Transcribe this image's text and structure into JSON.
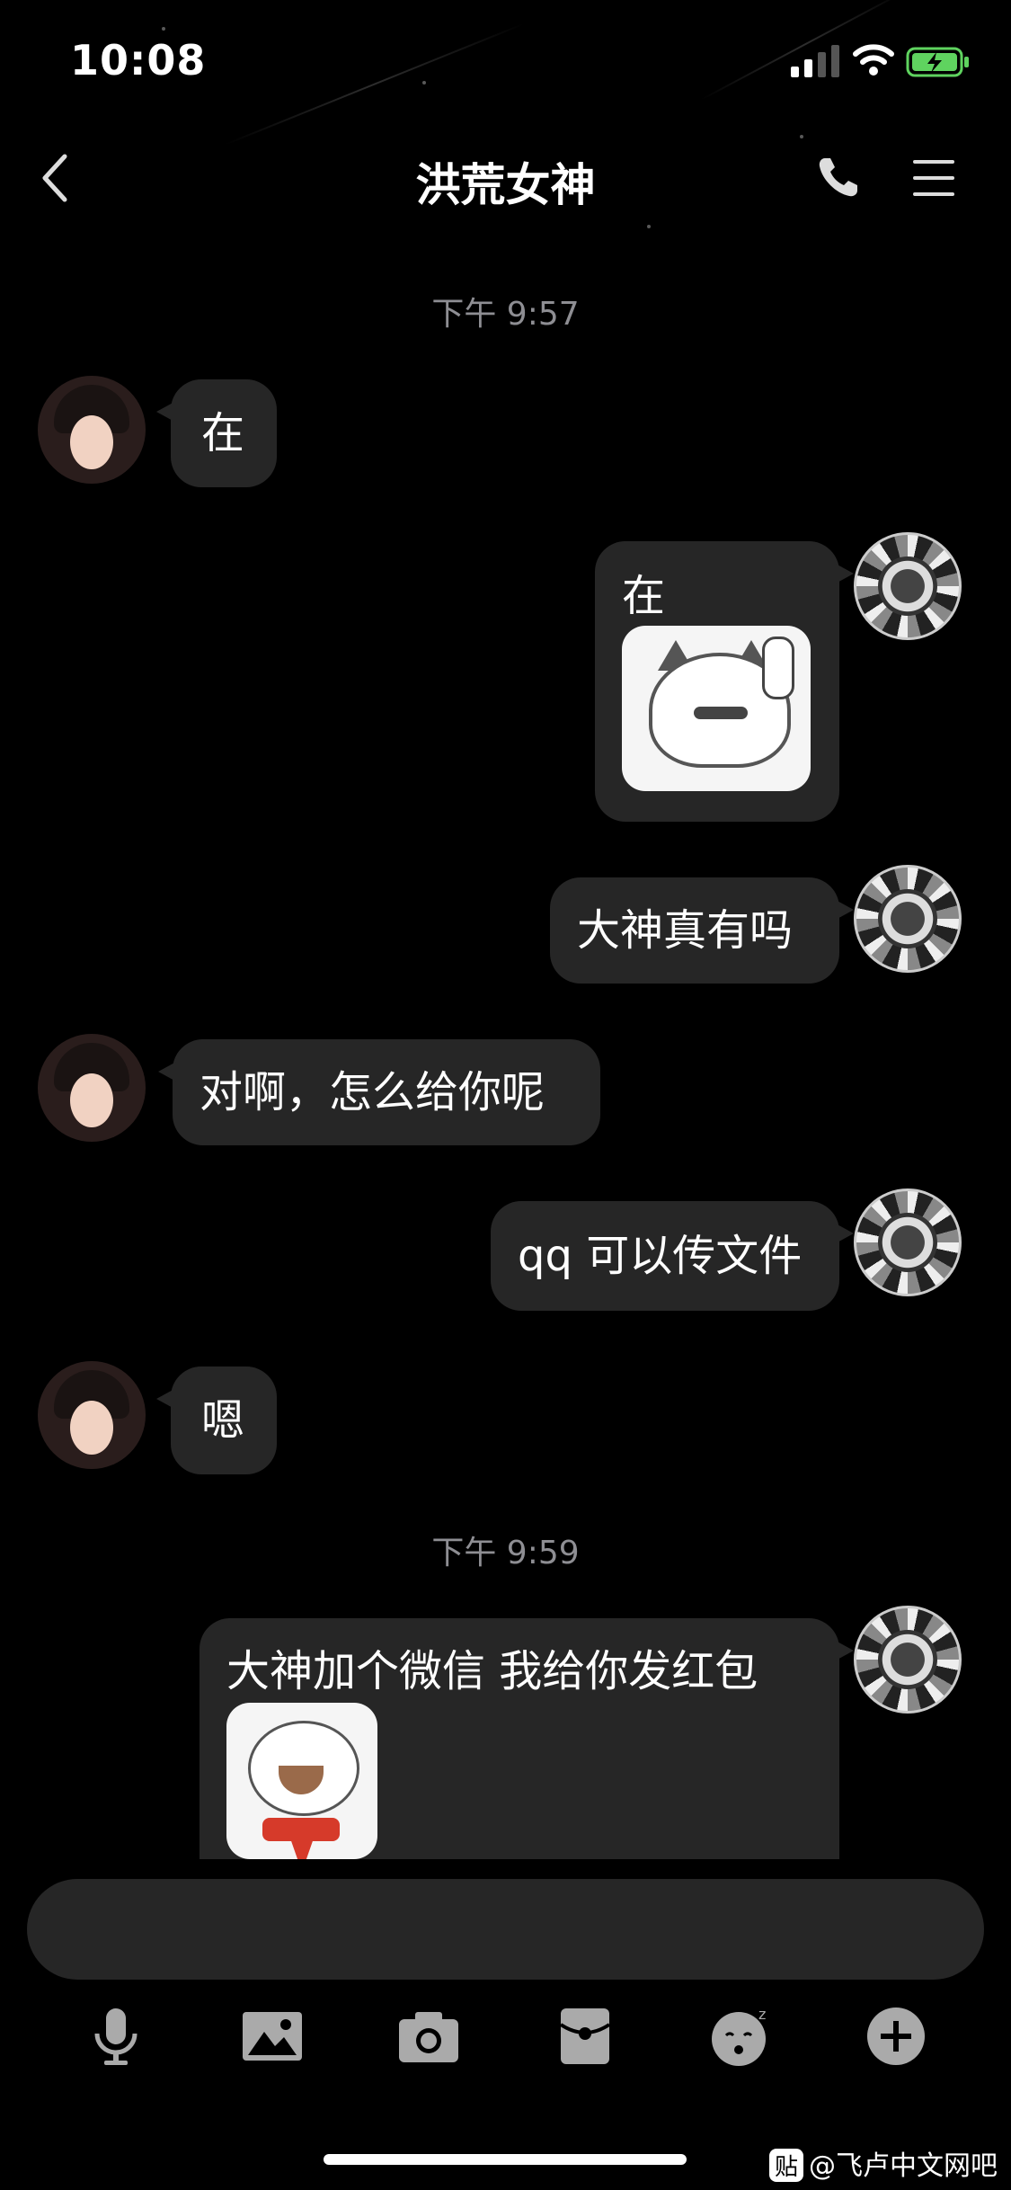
{
  "status_bar": {
    "time": "10:08"
  },
  "header": {
    "title": "洪荒女神"
  },
  "messages": [
    {
      "type": "time",
      "text": "下午 9:57"
    },
    {
      "type": "msg",
      "side": "left",
      "text": "在"
    },
    {
      "type": "msg",
      "side": "right",
      "text": "在",
      "sticker": "cat-sticker"
    },
    {
      "type": "msg",
      "side": "right",
      "text": "大神真有吗"
    },
    {
      "type": "msg",
      "side": "left",
      "text": "对啊，怎么给你呢"
    },
    {
      "type": "msg",
      "side": "right",
      "text": "qq 可以传文件"
    },
    {
      "type": "msg",
      "side": "left",
      "text": "嗯"
    },
    {
      "type": "time",
      "text": "下午 9:59"
    },
    {
      "type": "msg",
      "side": "right",
      "text": "大神加个微信 我给你发红包",
      "sticker": "bear-sticker"
    }
  ],
  "toolbar": {
    "items": [
      "microphone-icon",
      "image-icon",
      "camera-icon",
      "red-packet-icon",
      "emoji-icon",
      "plus-icon"
    ]
  },
  "watermark": {
    "badge": "贴",
    "text": "@飞卢中文网吧"
  },
  "colors": {
    "background": "#000000",
    "bubble": "#262626",
    "timestamp": "#8e8e93"
  }
}
